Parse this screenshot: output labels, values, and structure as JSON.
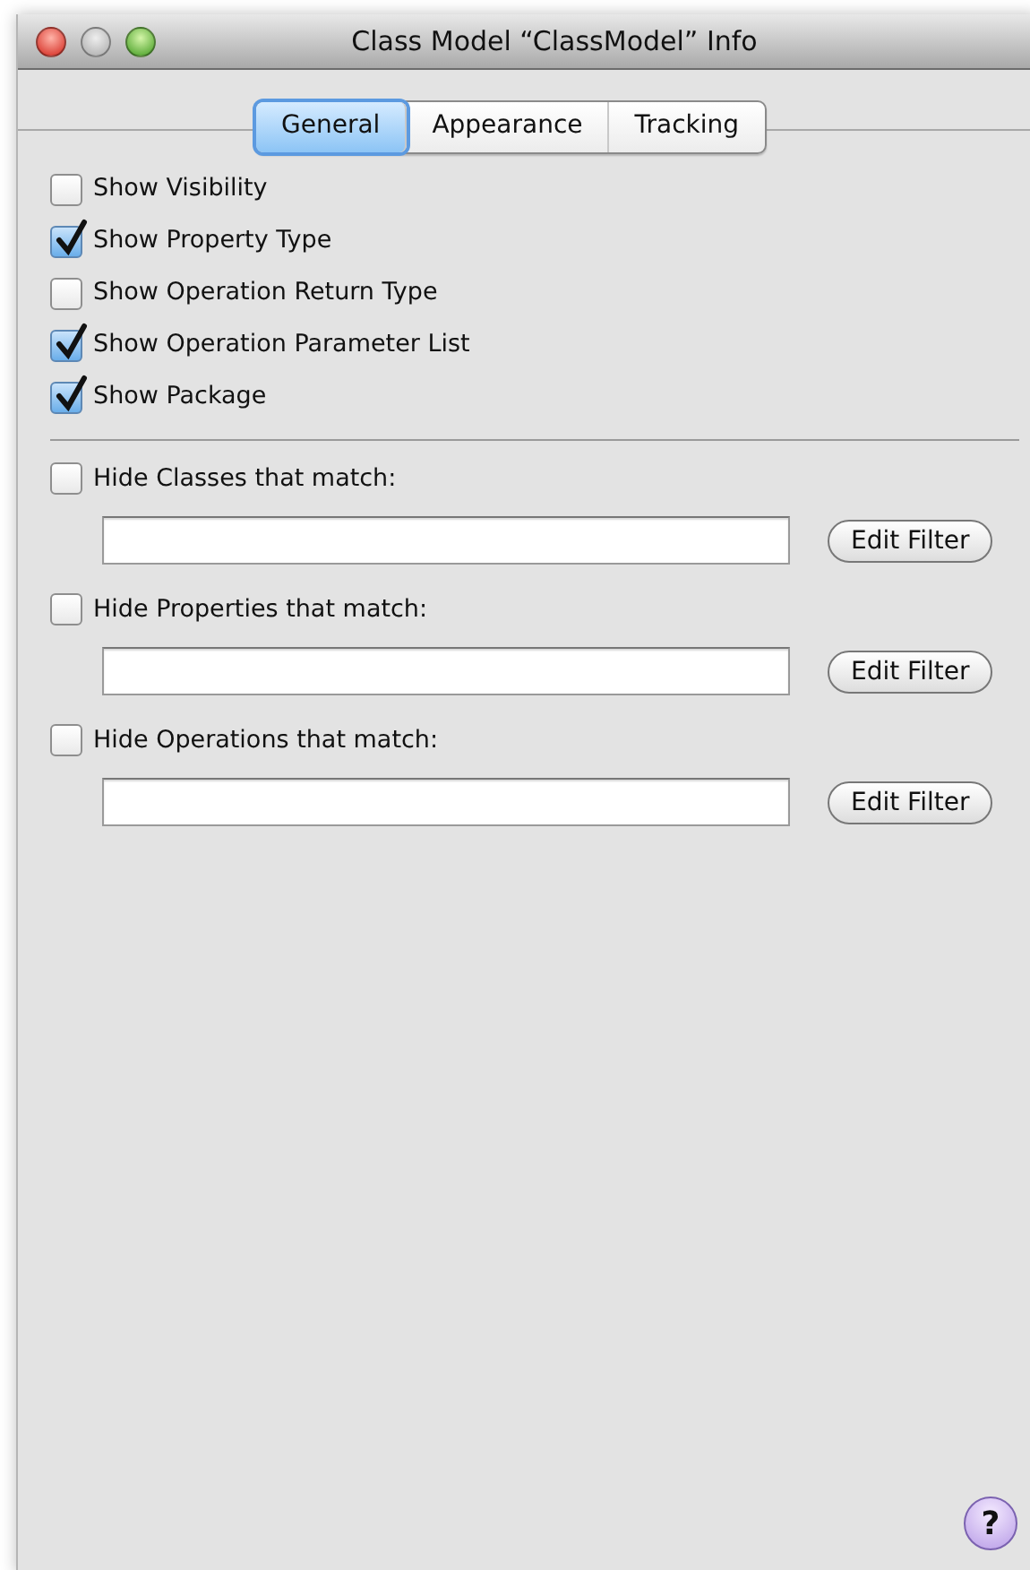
{
  "window": {
    "title": "Class Model “ClassModel” Info"
  },
  "tabs": [
    {
      "label": "General",
      "selected": true
    },
    {
      "label": "Appearance",
      "selected": false
    },
    {
      "label": "Tracking",
      "selected": false
    }
  ],
  "options": [
    {
      "label": "Show Visibility",
      "checked": false
    },
    {
      "label": "Show Property Type",
      "checked": true
    },
    {
      "label": "Show Operation Return Type",
      "checked": false
    },
    {
      "label": "Show Operation Parameter List",
      "checked": true
    },
    {
      "label": "Show Package",
      "checked": true
    }
  ],
  "filters": [
    {
      "label": "Hide Classes that match:",
      "checked": false,
      "button": "Edit Filter"
    },
    {
      "label": "Hide Properties that match:",
      "checked": false,
      "button": "Edit Filter"
    },
    {
      "label": "Hide Operations that match:",
      "checked": false,
      "button": "Edit Filter"
    }
  ],
  "help": "?"
}
